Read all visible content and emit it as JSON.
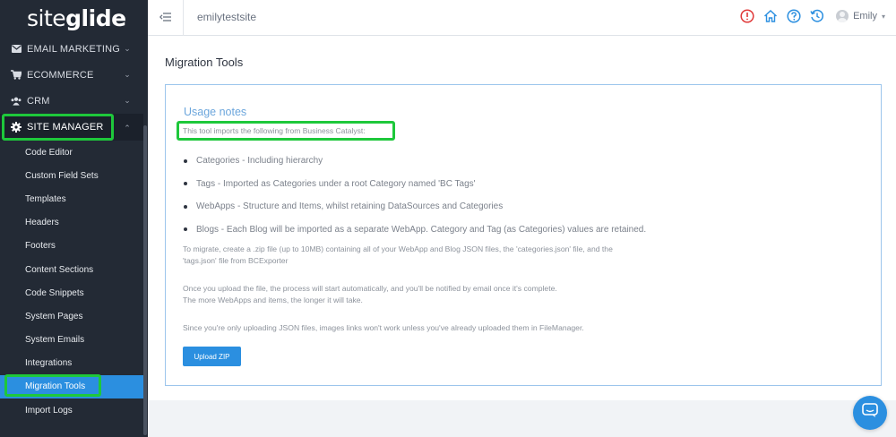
{
  "sidebar": {
    "logo_light": "site",
    "logo_bold": "glide",
    "sections": [
      {
        "label": "EMAIL MARKETING",
        "icon": "envelope-icon"
      },
      {
        "label": "ECOMMERCE",
        "icon": "cart-icon"
      },
      {
        "label": "CRM",
        "icon": "users-icon"
      },
      {
        "label": "SITE MANAGER",
        "icon": "gear-icon"
      }
    ],
    "sub_items": [
      "Code Editor",
      "Custom Field Sets",
      "Templates",
      "Headers",
      "Footers",
      "Content Sections",
      "Code Snippets",
      "System Pages",
      "System Emails",
      "Integrations",
      "Migration Tools",
      "Import Logs"
    ],
    "active_sub_item": "Migration Tools"
  },
  "topbar": {
    "site_name": "emilytestsite",
    "user_name": "Emily",
    "icons": [
      "alert-icon",
      "home-icon",
      "help-icon",
      "history-icon"
    ]
  },
  "main": {
    "page_title": "Migration Tools",
    "usage_title": "Usage notes",
    "intro": "This tool imports the following from Business Catalyst:",
    "bullets": [
      "Categories - Including hierarchy",
      "Tags - Imported as Categories under a root Category named 'BC Tags'",
      "WebApps - Structure and Items, whilst retaining DataSources and Categories",
      "Blogs - Each Blog will be imported as a separate WebApp. Category and Tag (as Categories) values are retained."
    ],
    "para1_line1": "To migrate, create a .zip file (up to 10MB) containing all of your WebApp and Blog JSON files, the 'categories.json' file, and the",
    "para1_line2": "'tags.json' file from BCExporter",
    "para2_line1": "Once you upload the file, the process will start automatically, and you'll be notified by email once it's complete.",
    "para2_line2": "The more WebApps and items, the longer it will take.",
    "para3": "Since you're only uploading JSON files, images links won't work unless you've already uploaded them in FileManager.",
    "upload_button": "Upload ZIP"
  },
  "colors": {
    "sidebar_bg": "#232a35",
    "accent": "#2b8fe0",
    "highlight": "#1ec83b",
    "alert": "#e03a3a"
  }
}
